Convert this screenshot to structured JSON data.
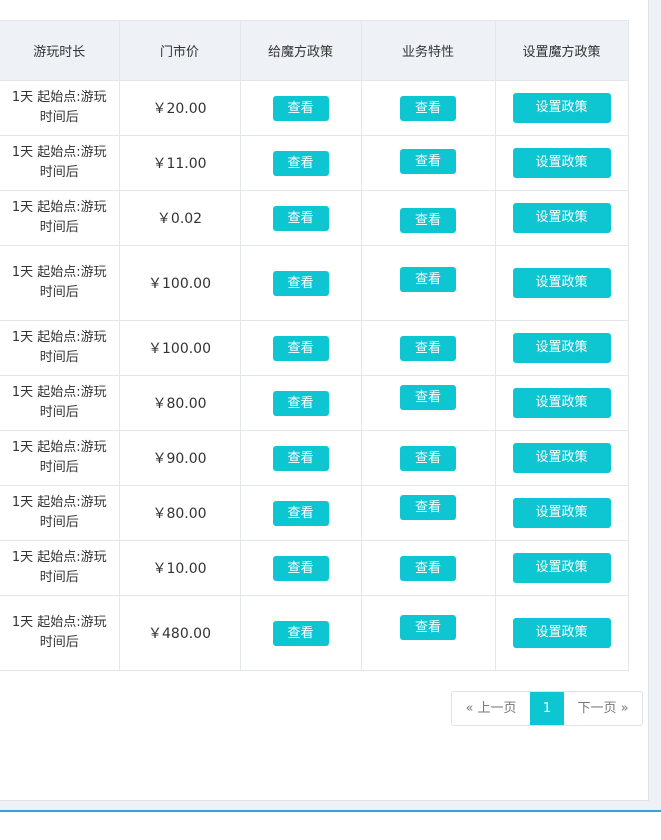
{
  "table": {
    "headers": {
      "duration": "游玩时长",
      "price": "门市价",
      "give_policy": "给魔方政策",
      "business": "业务特性",
      "set_policy": "设置魔方政策"
    },
    "rows": [
      {
        "duration_line1": "1天 起始点:游玩",
        "duration_line2": "时间后",
        "price": "￥20.00",
        "view_policy": "查看",
        "view_business": "查看",
        "set_policy": "设置政策"
      },
      {
        "duration_line1": "1天 起始点:游玩",
        "duration_line2": "时间后",
        "price": "￥11.00",
        "view_policy": "查看",
        "view_business": "查看",
        "set_policy": "设置政策"
      },
      {
        "duration_line1": "1天 起始点:游玩",
        "duration_line2": "时间后",
        "price": "￥0.02",
        "view_policy": "查看",
        "view_business": "查看",
        "set_policy": "设置政策"
      },
      {
        "duration_line1": "1天 起始点:游玩",
        "duration_line2": "时间后",
        "price": "￥100.00",
        "view_policy": "查看",
        "view_business": "查看",
        "set_policy": "设置政策"
      },
      {
        "duration_line1": "1天 起始点:游玩",
        "duration_line2": "时间后",
        "price": "￥100.00",
        "view_policy": "查看",
        "view_business": "查看",
        "set_policy": "设置政策"
      },
      {
        "duration_line1": "1天 起始点:游玩",
        "duration_line2": "时间后",
        "price": "￥80.00",
        "view_policy": "查看",
        "view_business": "查看",
        "set_policy": "设置政策"
      },
      {
        "duration_line1": "1天 起始点:游玩",
        "duration_line2": "时间后",
        "price": "￥90.00",
        "view_policy": "查看",
        "view_business": "查看",
        "set_policy": "设置政策"
      },
      {
        "duration_line1": "1天 起始点:游玩",
        "duration_line2": "时间后",
        "price": "￥80.00",
        "view_policy": "查看",
        "view_business": "查看",
        "set_policy": "设置政策"
      },
      {
        "duration_line1": "1天 起始点:游玩",
        "duration_line2": "时间后",
        "price": "￥10.00",
        "view_policy": "查看",
        "view_business": "查看",
        "set_policy": "设置政策"
      },
      {
        "duration_line1": "1天 起始点:游玩",
        "duration_line2": "时间后",
        "price": "￥480.00",
        "view_policy": "查看",
        "view_business": "查看",
        "set_policy": "设置政策"
      }
    ]
  },
  "pagination": {
    "prev_label": "« 上一页",
    "current_page": "1",
    "next_label": "下一页 »"
  },
  "colors": {
    "accent": "#0ec5d2",
    "header_bg": "#eef1f6",
    "border": "#e3e6eb"
  }
}
